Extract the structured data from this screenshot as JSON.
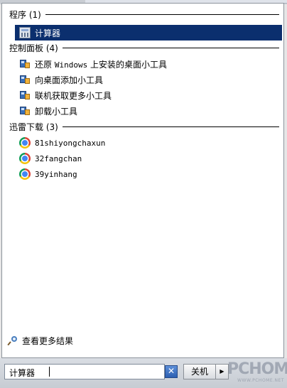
{
  "groups": [
    {
      "title": "程序 (1)",
      "items": [
        {
          "label": "计算器",
          "icon": "calculator-icon",
          "selected": true
        }
      ]
    },
    {
      "title": "控制面板 (4)",
      "items": [
        {
          "label_prefix": "还原 ",
          "label_mono": "Windows",
          "label_suffix": " 上安装的桌面小工具",
          "icon": "gadget-icon"
        },
        {
          "label": "向桌面添加小工具",
          "icon": "gadget-icon"
        },
        {
          "label": "联机获取更多小工具",
          "icon": "gadget-icon"
        },
        {
          "label": "卸载小工具",
          "icon": "gadget-icon"
        }
      ]
    },
    {
      "title": "迅雷下载 (3)",
      "items": [
        {
          "label": "81shiyongchaxun",
          "icon": "chrome-icon"
        },
        {
          "label": "32fangchan",
          "icon": "chrome-icon"
        },
        {
          "label": "39yinhang",
          "icon": "chrome-icon"
        }
      ]
    }
  ],
  "see_more": {
    "label": "查看更多结果",
    "icon": "magnifier-icon"
  },
  "search": {
    "value": "计算器"
  },
  "shutdown": {
    "label": "关机"
  },
  "watermark": {
    "main": "PCHOME",
    "sub": "WWW.PCHOME.NET"
  },
  "colors": {
    "selection": "#0b2f6e",
    "menu_bg": "#ffffff"
  }
}
